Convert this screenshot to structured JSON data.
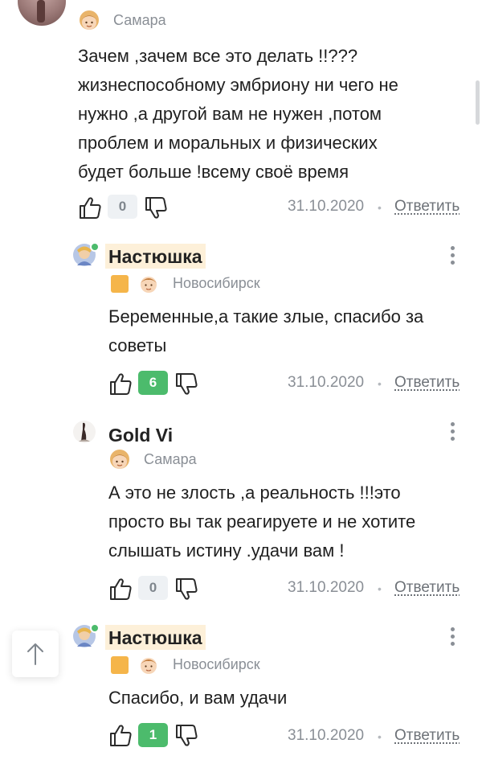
{
  "comments": [
    {
      "city": "Самара",
      "text_lines": [
        "Зачем ,зачем все это делать !!???",
        "жизнеспособному эмбриону ни чего не",
        "нужно ,а другой вам не нужен ,потом",
        "проблем и моральных и физических",
        "будет больше !всему своё время"
      ],
      "likes": "0",
      "date": "31.10.2020",
      "reply": "Ответить"
    },
    {
      "name": "Настюшка",
      "city": "Новосибирск",
      "text_lines": [
        "Беременные,а такие злые, спасибо за",
        "советы"
      ],
      "likes": "6",
      "date": "31.10.2020",
      "reply": "Ответить"
    },
    {
      "name": "Gold Vi",
      "city": "Самара",
      "text_lines": [
        "А это не злость ,а реальность !!!это",
        "просто вы так реагируете и не хотите",
        "слышать истину .удачи вам !"
      ],
      "likes": "0",
      "date": "31.10.2020",
      "reply": "Ответить"
    },
    {
      "name": "Настюшка",
      "city": "Новосибирск",
      "text_lines": [
        "Спасибо, и вам удачи"
      ],
      "likes": "1",
      "date": "31.10.2020",
      "reply": "Ответить"
    }
  ],
  "colors": {
    "accent_green": "#4cbb6c",
    "name_highlight": "#fdf0d9",
    "status_orange": "#f5b54a"
  },
  "icons": {
    "like": "thumbs-up-icon",
    "dislike": "thumbs-down-icon",
    "more": "more-dots-icon",
    "scroll_top": "arrow-up-icon"
  }
}
